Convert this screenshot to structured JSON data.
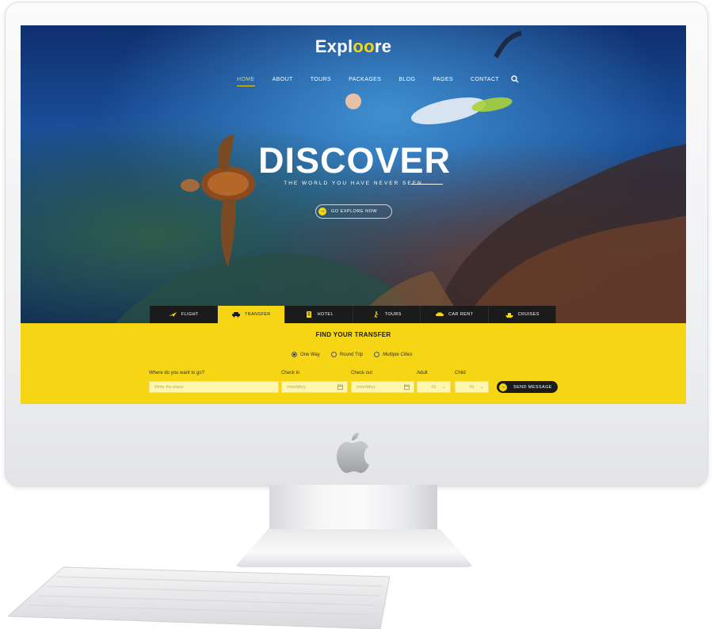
{
  "site": {
    "brand_prefix": "Expl",
    "brand_highlight": "oo",
    "brand_suffix": "re",
    "accent_color": "#f5d514",
    "dark_color": "#1b1b1b"
  },
  "nav": {
    "items": [
      "HOME",
      "ABOUT",
      "TOURS",
      "PACKAGES",
      "BLOG",
      "PAGES",
      "CONTACT"
    ],
    "active": "HOME",
    "search_icon": "search-icon"
  },
  "hero": {
    "headline": "DISCOVER",
    "subline": "THE WORLD YOU HAVE NEVER SEEN",
    "cta_label": "GO EXPLORE NOW",
    "cta_icon": "arrow-right-icon"
  },
  "tabs": {
    "items": [
      {
        "label": "FLIGHT",
        "icon": "plane-icon"
      },
      {
        "label": "TRANSFER",
        "icon": "car-icon"
      },
      {
        "label": "HOTEL",
        "icon": "hotel-icon"
      },
      {
        "label": "TOURS",
        "icon": "hiker-icon"
      },
      {
        "label": "CAR RENT",
        "icon": "car-rent-icon"
      },
      {
        "label": "CRUISES",
        "icon": "ship-icon"
      }
    ],
    "active": "TRANSFER"
  },
  "booking": {
    "title": "FIND YOUR TRANSFER",
    "trip_options": [
      "One Way",
      "Round Trip",
      "Multiple Cities"
    ],
    "selected_option": "One Way",
    "destination_label": "Where do you want to go?",
    "destination_placeholder": "Write the place",
    "checkin_label": "Check in",
    "checkin_placeholder": "mm/dd/yy",
    "checkout_label": "Check out",
    "checkout_placeholder": "mm/dd/yy",
    "adult_label": "Adult",
    "adult_value": "01",
    "child_label": "Child",
    "child_value": "01",
    "submit_label": "SEND MESSAGE"
  }
}
